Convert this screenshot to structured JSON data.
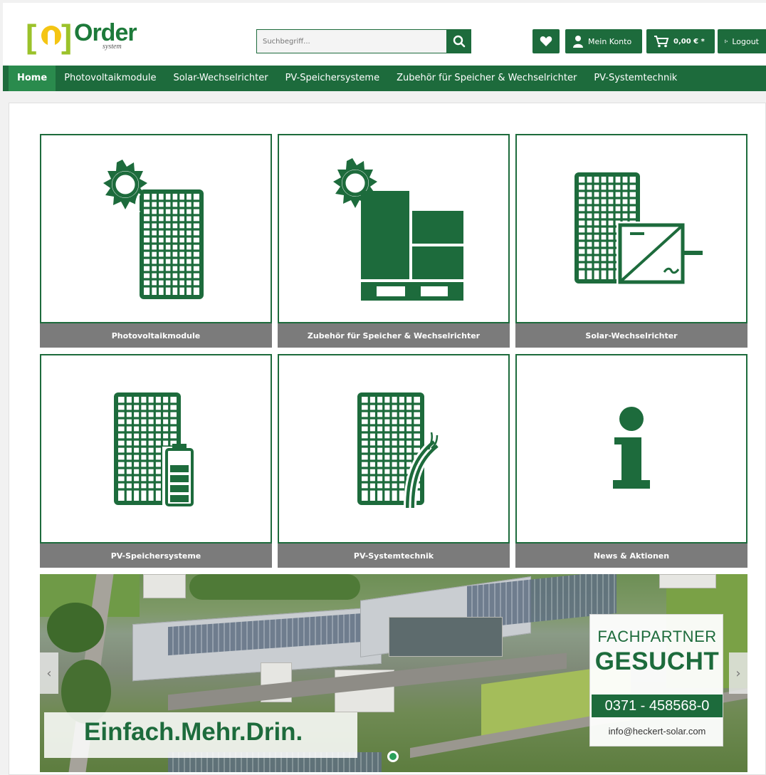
{
  "logo": {
    "text": "Order",
    "subtext": "system"
  },
  "search": {
    "placeholder": "Suchbegriff..."
  },
  "header": {
    "account_label": "Mein Konto",
    "cart_label": "0,00 € *",
    "logout_label": "Logout"
  },
  "nav": {
    "items": [
      {
        "label": "Home"
      },
      {
        "label": "Photovoltaikmodule"
      },
      {
        "label": "Solar-Wechselrichter"
      },
      {
        "label": "PV-Speichersysteme"
      },
      {
        "label": "Zubehör für Speicher & Wechselrichter"
      },
      {
        "label": "PV-Systemtechnik"
      }
    ]
  },
  "tiles": [
    {
      "label": "Photovoltaikmodule",
      "icon": "solar-module-sun-icon"
    },
    {
      "label": "Zubehör für Speicher & Wechselrichter",
      "icon": "pallet-boxes-sun-icon"
    },
    {
      "label": "Solar-Wechselrichter",
      "icon": "module-inverter-icon"
    },
    {
      "label": "PV-Speichersysteme",
      "icon": "module-battery-icon"
    },
    {
      "label": "PV-Systemtechnik",
      "icon": "module-cable-icon"
    },
    {
      "label": "News & Aktionen",
      "icon": "info-icon"
    }
  ],
  "banner": {
    "promo_title": "FACHPARTNER",
    "promo_big": "GESUCHT",
    "promo_phone": "0371 - 458568-0",
    "promo_email": "info@heckert-solar.com",
    "slogan": "Einfach.Mehr.Drin."
  },
  "colors": {
    "brand": "#1d6b3c",
    "tile_label_bg": "#7b7b7b",
    "logo_green": "#9bc22a",
    "logo_yellow": "#f4c513"
  }
}
